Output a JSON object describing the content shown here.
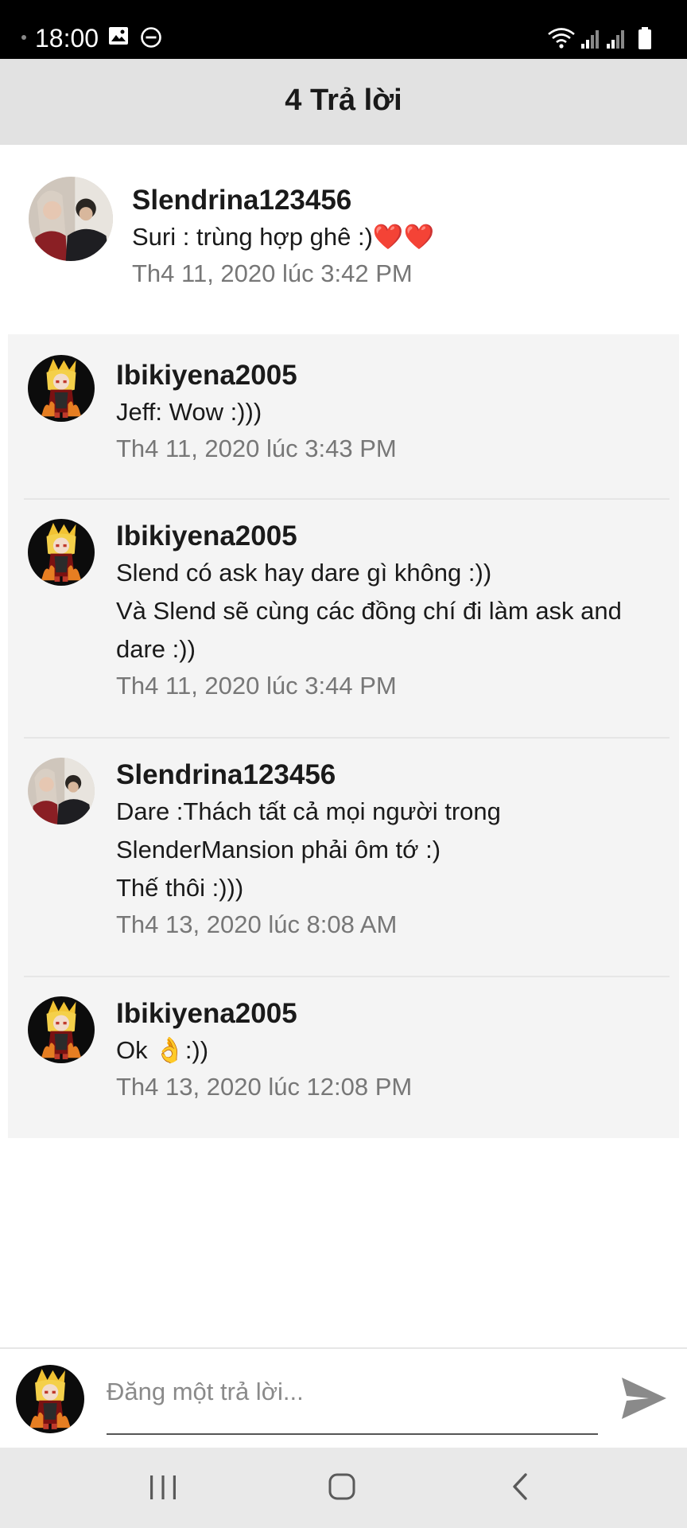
{
  "status_bar": {
    "time": "18:00",
    "icons": [
      "gallery-icon",
      "do-not-disturb-icon",
      "wifi-icon",
      "signal-icon",
      "signal-icon",
      "battery-icon"
    ]
  },
  "header": {
    "title": "4 Trả lời"
  },
  "parent_comment": {
    "username": "Slendrina123456",
    "text": "Suri : trùng hợp ghê :)❤️❤️",
    "date": "Th4 11, 2020 lúc 3:42 PM",
    "avatar_icon": "user-photo-avatar"
  },
  "replies": [
    {
      "username": "Ibikiyena2005",
      "text": "Jeff: Wow :)))",
      "date": "Th4 11, 2020 lúc 3:43 PM",
      "avatar_icon": "anime-character-avatar"
    },
    {
      "username": "Ibikiyena2005",
      "text": "Slend có ask hay dare gì không :))\nVà Slend sẽ cùng các đồng chí đi làm ask and dare :))",
      "date": "Th4 11, 2020 lúc 3:44 PM",
      "avatar_icon": "anime-character-avatar"
    },
    {
      "username": "Slendrina123456",
      "text": "Dare :Thách tất cả mọi người trong SlenderMansion phải ôm tớ :)\nThế thôi :)))",
      "date": "Th4 13, 2020 lúc 8:08 AM",
      "avatar_icon": "user-photo-avatar"
    },
    {
      "username": "Ibikiyena2005",
      "text": "Ok 👌:))",
      "date": "Th4 13, 2020 lúc 12:08 PM",
      "avatar_icon": "anime-character-avatar"
    }
  ],
  "composer": {
    "placeholder": "Đăng một trả lời...",
    "value": "",
    "send_icon": "send-icon"
  },
  "navbar": {
    "buttons": [
      "recents-icon",
      "home-icon",
      "back-icon"
    ]
  },
  "colors": {
    "header_bg": "#e2e2e2",
    "replies_bg": "#f4f4f4",
    "muted_text": "#777777",
    "send_icon": "#8a8a8a"
  }
}
